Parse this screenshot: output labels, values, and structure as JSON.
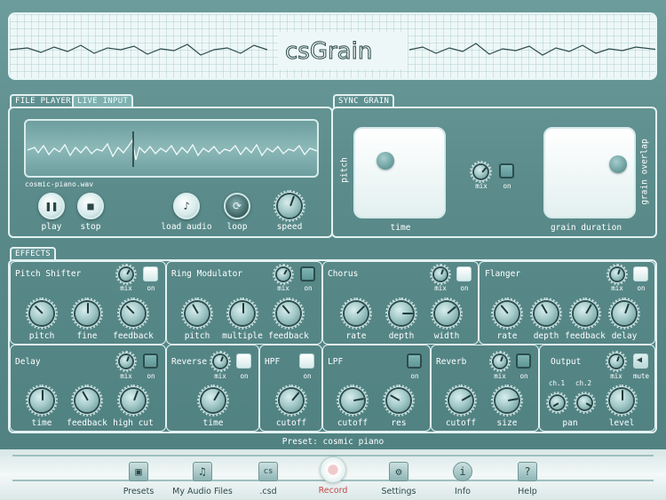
{
  "app": {
    "logo_text": "csGrain"
  },
  "file_player": {
    "tabs": [
      "FILE PLAYER",
      "LIVE INPUT"
    ],
    "filename": "cosmic-piano.wav",
    "play_label": "play",
    "stop_label": "stop",
    "load_label": "load audio",
    "loop_label": "loop",
    "speed_label": "speed"
  },
  "sync_grain": {
    "tab": "SYNC GRAIN",
    "pitch_label": "pitch",
    "time_label": "time",
    "mix_label": "mix",
    "on_label": "on",
    "grain_duration_label": "grain duration",
    "grain_overlap_label": "grain overlap"
  },
  "effects": {
    "tab": "EFFECTS",
    "mix_label": "mix",
    "on_label": "on",
    "pitch_shifter": {
      "title": "Pitch Shifter",
      "knobs": [
        "pitch",
        "fine",
        "feedback"
      ]
    },
    "ring_modulator": {
      "title": "Ring Modulator",
      "knobs": [
        "pitch",
        "multiple",
        "feedback"
      ]
    },
    "chorus": {
      "title": "Chorus",
      "knobs": [
        "rate",
        "depth",
        "width"
      ]
    },
    "flanger": {
      "title": "Flanger",
      "knobs": [
        "rate",
        "depth",
        "feedback",
        "delay"
      ]
    },
    "delay": {
      "title": "Delay",
      "knobs": [
        "time",
        "feedback",
        "high cut"
      ]
    },
    "reverse": {
      "title": "Reverse",
      "knobs": [
        "time"
      ]
    },
    "hpf": {
      "title": "HPF",
      "knobs": [
        "cutoff"
      ]
    },
    "lpf": {
      "title": "LPF",
      "knobs": [
        "cutoff",
        "res"
      ]
    },
    "reverb": {
      "title": "Reverb",
      "knobs": [
        "cutoff",
        "size"
      ]
    },
    "output": {
      "title": "Output",
      "mute_label": "mute",
      "ch1": "ch.1",
      "ch2": "ch.2",
      "knobs": [
        "pan",
        "level"
      ]
    }
  },
  "preset": {
    "text": "Preset: cosmic piano"
  },
  "nav": [
    {
      "label": "Presets",
      "icon": "save-icon"
    },
    {
      "label": "My Audio Files",
      "icon": "music-file-icon"
    },
    {
      "label": ".csd",
      "icon": "csd-file-icon"
    },
    {
      "label": "Record",
      "icon": "record-icon"
    },
    {
      "label": "Settings",
      "icon": "gear-icon"
    },
    {
      "label": "Info",
      "icon": "info-icon"
    },
    {
      "label": "Help",
      "icon": "help-icon"
    }
  ],
  "colors": {
    "background": "#5f9090",
    "record": "#c44b4b",
    "panel_border": "#e3f2f2"
  }
}
